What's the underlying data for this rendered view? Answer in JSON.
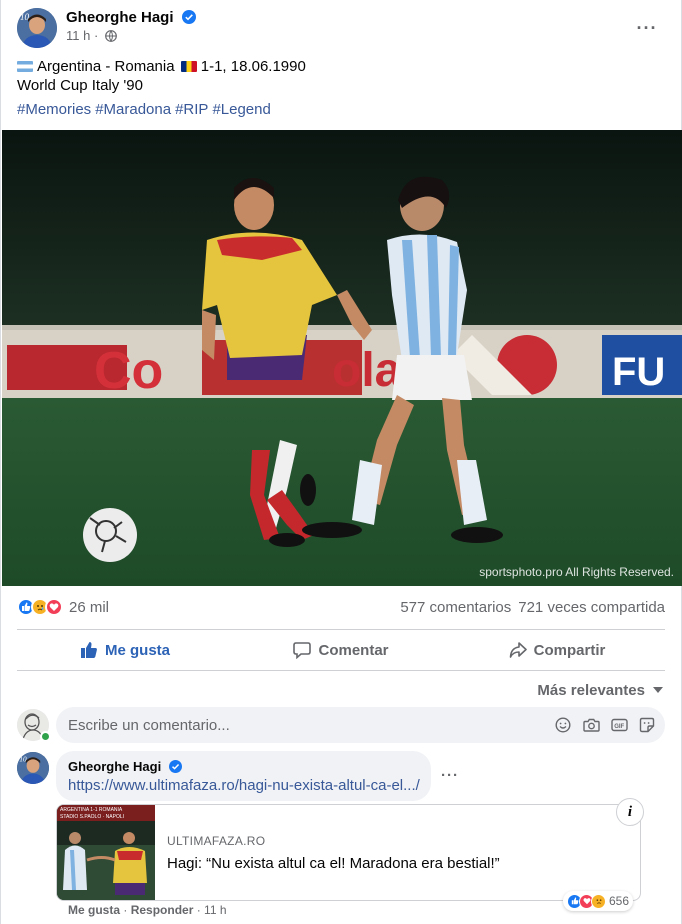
{
  "post": {
    "author": "Gheorghe Hagi",
    "time": "11 h",
    "line1": "Argentina - Romania",
    "line1_score": "1-1, 18.06.1990",
    "line2": "World Cup Italy '90",
    "hashtags": [
      "#Memories",
      "#Maradona",
      "#RIP",
      "#Legend"
    ],
    "photo_credit": "sportsphoto.pro All Rights Reserved."
  },
  "stats": {
    "reactions": "26 mil",
    "comments": "577 comentarios",
    "shares": "721 veces compartida"
  },
  "actions": {
    "like": "Me gusta",
    "comment": "Comentar",
    "share": "Compartir"
  },
  "sort_label": "Más relevantes",
  "composer": {
    "placeholder": "Escribe un comentario..."
  },
  "comment": {
    "author": "Gheorghe Hagi",
    "link": "https://www.ultimafaza.ro/hagi-nu-exista-altul-ca-el.../",
    "preview_domain": "ULTIMAFAZA.RO",
    "preview_title": "Hagi: “Nu exista altul ca el! Maradona era bestial!”",
    "reactions": "656",
    "like": "Me gusta",
    "reply": "Responder",
    "time": "11 h",
    "info_label": "i"
  },
  "colors": {
    "link": "#385898",
    "liked": "#2d63b6",
    "like_reaction": "#1877f2",
    "love_reaction": "#f33e58",
    "sad_reaction": "#f7b125"
  }
}
